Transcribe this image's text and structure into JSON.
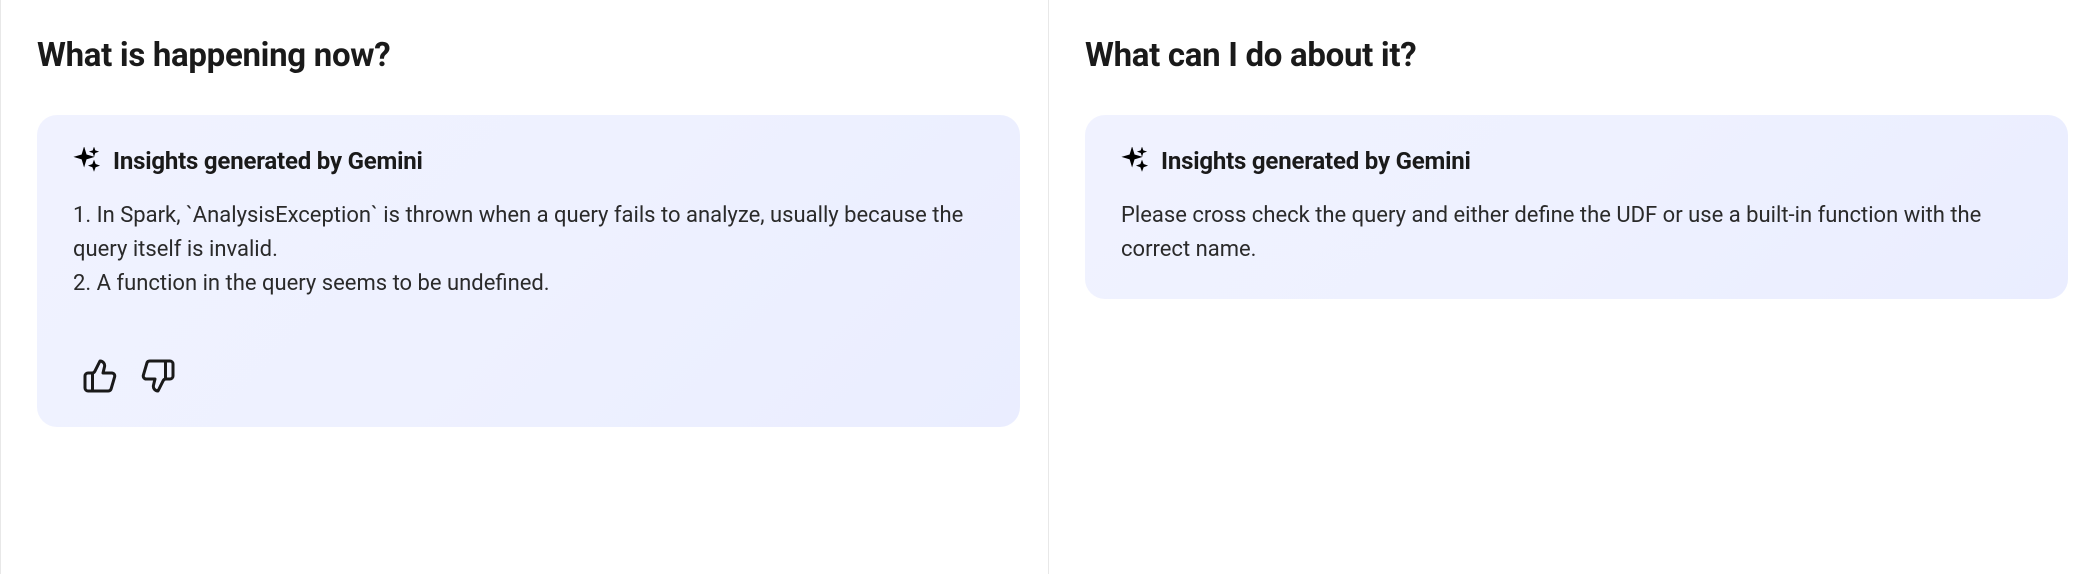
{
  "left_panel": {
    "heading": "What is happening now?",
    "insight_title": "Insights generated by Gemini",
    "insight_body": "1. In Spark, `AnalysisException` is thrown when a query fails to analyze, usually because the query itself is invalid.\n2. A function in the query seems to be undefined."
  },
  "right_panel": {
    "heading": "What can I do about it?",
    "insight_title": "Insights generated by Gemini",
    "insight_body": "Please cross check the query and either define the UDF or use a built-in function with the correct name."
  }
}
